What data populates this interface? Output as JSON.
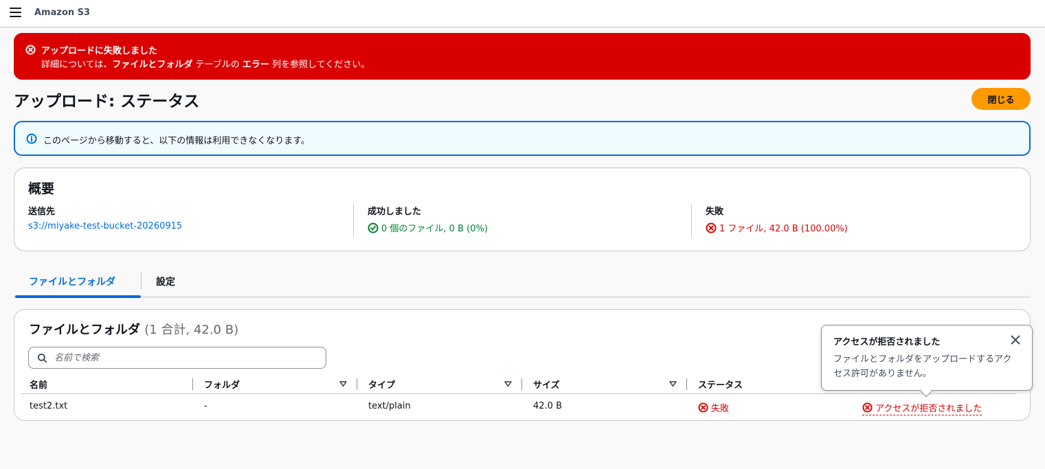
{
  "header": {
    "service_name": "Amazon S3"
  },
  "flash": {
    "title": "アップロードに失敗しました",
    "body_prefix": "詳細については、",
    "body_bold1": "ファイルとフォルダ",
    "body_mid": " テーブルの ",
    "body_bold2": "エラー",
    "body_suffix": " 列を参照してください。",
    "color": "#db0000"
  },
  "page": {
    "title": "アップロード: ステータス",
    "close_label": "閉じる"
  },
  "info_alert": {
    "text": "このページから移動すると、以下の情報は利用できなくなります。"
  },
  "summary": {
    "title": "概要",
    "destination": {
      "label": "送信先",
      "value": "s3://miyake-test-bucket-20260915"
    },
    "succeeded": {
      "label": "成功しました",
      "value": "0 個のファイル, 0 B (0%)"
    },
    "failed": {
      "label": "失敗",
      "value": "1 ファイル, 42.0 B (100.00%)"
    }
  },
  "tabs": [
    {
      "label": "ファイルとフォルダ",
      "active": true
    },
    {
      "label": "設定",
      "active": false
    }
  ],
  "files": {
    "title": "ファイルとフォルダ",
    "count": "(1 合計, 42.0 B)",
    "search_placeholder": "名前で検索",
    "columns": [
      "名前",
      "フォルダ",
      "タイプ",
      "サイズ",
      "ステータス"
    ],
    "rows": [
      {
        "name": "test2.txt",
        "folder": "-",
        "type": "text/plain",
        "size": "42.0 B",
        "status": "失敗",
        "error": "アクセスが拒否されました"
      }
    ]
  },
  "popover": {
    "title": "アクセスが拒否されました",
    "body": "ファイルとフォルダをアップロードするアクセス許可がありません。"
  },
  "colors": {
    "accent": "#006ce0",
    "primary_button": "#ff9900",
    "success": "#00802f",
    "error": "#db0000"
  }
}
